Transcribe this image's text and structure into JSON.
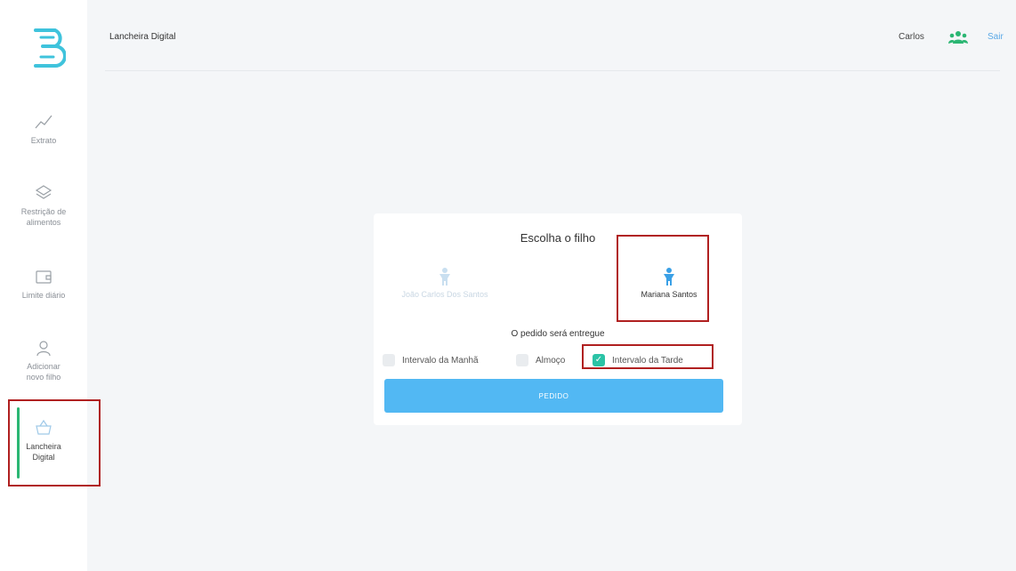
{
  "sidebar": {
    "items": [
      {
        "label": "Extrato",
        "icon": "chart-line-icon"
      },
      {
        "label": "Restrição de alimentos",
        "icon": "layers-icon"
      },
      {
        "label": "Limite diário",
        "icon": "wallet-icon"
      },
      {
        "label": "Adicionar novo filho",
        "icon": "user-add-icon"
      },
      {
        "label": "Lancheira Digital",
        "icon": "basket-icon"
      }
    ]
  },
  "header": {
    "title": "Lancheira Digital",
    "user_name": "Carlos",
    "exit_label": "Sair"
  },
  "card": {
    "title": "Escolha o filho",
    "children": [
      {
        "name": "João Carlos Dos Santos"
      },
      {
        "name": "Mariana Santos"
      }
    ],
    "delivery_label": "O pedido será entregue",
    "options": [
      {
        "label": "Intervalo da Manhã",
        "checked": false
      },
      {
        "label": "Almoço",
        "checked": false
      },
      {
        "label": "Intervalo da Tarde",
        "checked": true
      }
    ],
    "submit_label": "PEDIDO"
  },
  "colors": {
    "accent": "#2bb673",
    "primary_button": "#52b8f3",
    "checked": "#2bc3a6",
    "highlight": "#b02020"
  }
}
